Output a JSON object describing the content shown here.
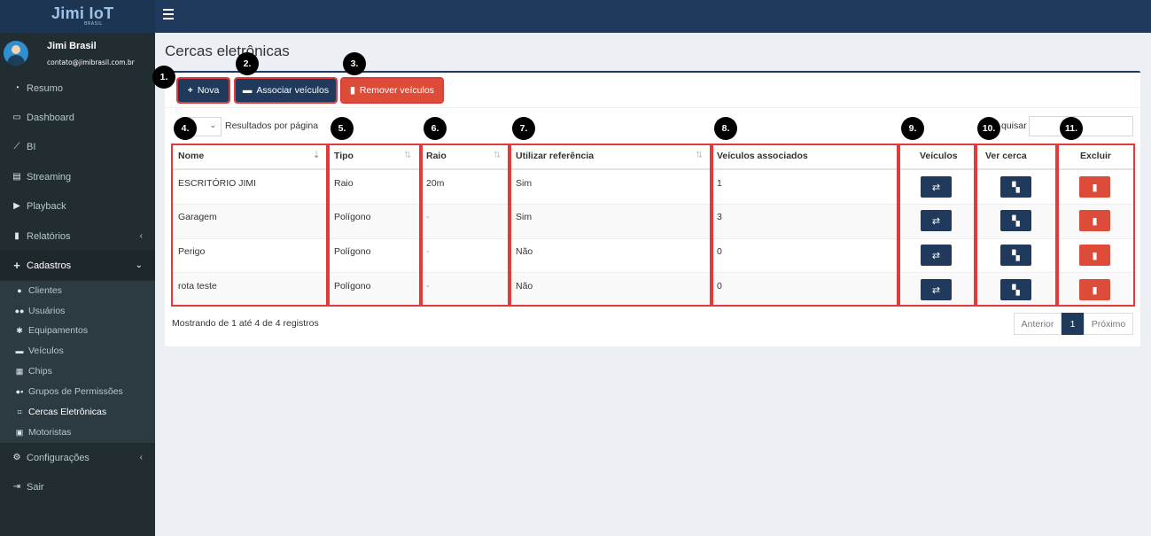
{
  "app": {
    "logo_main": "Jimi IoT",
    "logo_sub": "BRASIL"
  },
  "user": {
    "name": "Jimi Brasil",
    "email": "contato@jimibrasil.com.br"
  },
  "sidebar": {
    "items": [
      {
        "label": "Resumo",
        "icon": "pie-chart-icon"
      },
      {
        "label": "Dashboard",
        "icon": "monitor-icon"
      },
      {
        "label": "BI",
        "icon": "line-chart-icon"
      },
      {
        "label": "Streaming",
        "icon": "film-icon"
      },
      {
        "label": "Playback",
        "icon": "play-circle-icon"
      },
      {
        "label": "Relatórios",
        "icon": "file-icon"
      },
      {
        "label": "Cadastros",
        "icon": "plus-icon"
      },
      {
        "label": "Configurações",
        "icon": "gear-icon"
      },
      {
        "label": "Sair",
        "icon": "sign-out-icon"
      }
    ],
    "submenu": [
      {
        "label": "Clientes",
        "icon": "user-icon"
      },
      {
        "label": "Usuários",
        "icon": "users-icon"
      },
      {
        "label": "Equipamentos",
        "icon": "puzzle-icon"
      },
      {
        "label": "Veículos",
        "icon": "car-icon"
      },
      {
        "label": "Chips",
        "icon": "sim-card-icon"
      },
      {
        "label": "Grupos de Permissões",
        "icon": "user-group-icon"
      },
      {
        "label": "Cercas Eletrônicas",
        "icon": "fence-icon"
      },
      {
        "label": "Motoristas",
        "icon": "id-card-icon"
      }
    ]
  },
  "page": {
    "title": "Cercas eletrônicas"
  },
  "toolbar": {
    "nova_label": "Nova",
    "associar_label": "Associar veículos",
    "remover_label": "Remover veículos"
  },
  "badges": [
    "1.",
    "2.",
    "3.",
    "4.",
    "5.",
    "6.",
    "7.",
    "8.",
    "9.",
    "10.",
    "11."
  ],
  "table_controls": {
    "length_label": "Resultados por página",
    "search_label": "quisar"
  },
  "table": {
    "headers": [
      "Nome",
      "Tipo",
      "Raio",
      "Utilizar referência",
      "Veículos associados",
      "Veículos",
      "Ver cerca",
      "Excluir"
    ],
    "rows": [
      {
        "nome": "ESCRITÓRIO JIMI",
        "tipo": "Raio",
        "raio": "20m",
        "ref": "Sim",
        "assoc": "1"
      },
      {
        "nome": "Garagem",
        "tipo": "Polígono",
        "raio": "-",
        "ref": "Sim",
        "assoc": "3"
      },
      {
        "nome": "Perigo",
        "tipo": "Polígono",
        "raio": "-",
        "ref": "Não",
        "assoc": "0"
      },
      {
        "nome": "rota teste",
        "tipo": "Polígono",
        "raio": "-",
        "ref": "Não",
        "assoc": "0"
      }
    ]
  },
  "footer": {
    "info": "Mostrando de 1 até 4 de 4 registros",
    "prev": "Anterior",
    "page": "1",
    "next": "Próximo"
  },
  "colors": {
    "primary": "#1f3a5c",
    "danger": "#dd4b39",
    "highlight": "#e03b3b"
  }
}
